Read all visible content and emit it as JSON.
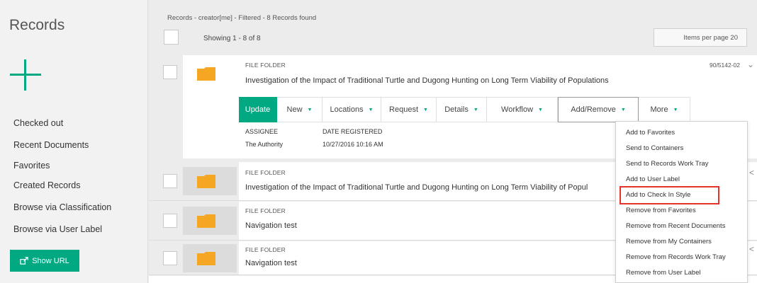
{
  "sidebar": {
    "title": "Records",
    "items": [
      {
        "label": "Checked out"
      },
      {
        "label": "Recent Documents"
      },
      {
        "label": "Favorites"
      },
      {
        "label": "Created Records"
      },
      {
        "label": "Browse via Classification"
      },
      {
        "label": "Browse via User Label"
      }
    ],
    "show_url_label": "Show URL"
  },
  "header": {
    "summary": "Records - creator[me] - Filtered - 8 Records found",
    "showing": "Showing 1 - 8 of 8",
    "items_per_page": "Items per page 20"
  },
  "records": [
    {
      "type": "FILE FOLDER",
      "title": "Investigation of the Impact of Traditional Turtle and Dugong Hunting on Long Term Viability of Populations",
      "code": "90/5142-02"
    },
    {
      "type": "FILE FOLDER",
      "title": "Investigation of the Impact of Traditional Turtle and Dugong Hunting on Long Term Viability of Popul"
    },
    {
      "type": "FILE FOLDER",
      "title": "Navigation test"
    },
    {
      "type": "FILE FOLDER",
      "title": "Navigation test"
    }
  ],
  "actions": {
    "update": "Update",
    "new": "New",
    "locations": "Locations",
    "request": "Request",
    "details": "Details",
    "workflow": "Workflow",
    "add_remove": "Add/Remove",
    "more": "More"
  },
  "meta": {
    "assignee_label": "ASSIGNEE",
    "assignee_value": "The Authority",
    "date_label": "DATE REGISTERED",
    "date_value": "10/27/2016 10:16 AM"
  },
  "menu": {
    "items": [
      "Add to Favorites",
      "Send to Containers",
      "Send to Records Work Tray",
      "Add to User Label",
      "Add to Check In Style",
      "Remove from Favorites",
      "Remove from Recent Documents",
      "Remove from My Containers",
      "Remove from Records Work Tray",
      "Remove from User Label"
    ]
  },
  "colors": {
    "accent": "#01a982",
    "highlight": "#e5322d",
    "folder": "#f5a623"
  }
}
